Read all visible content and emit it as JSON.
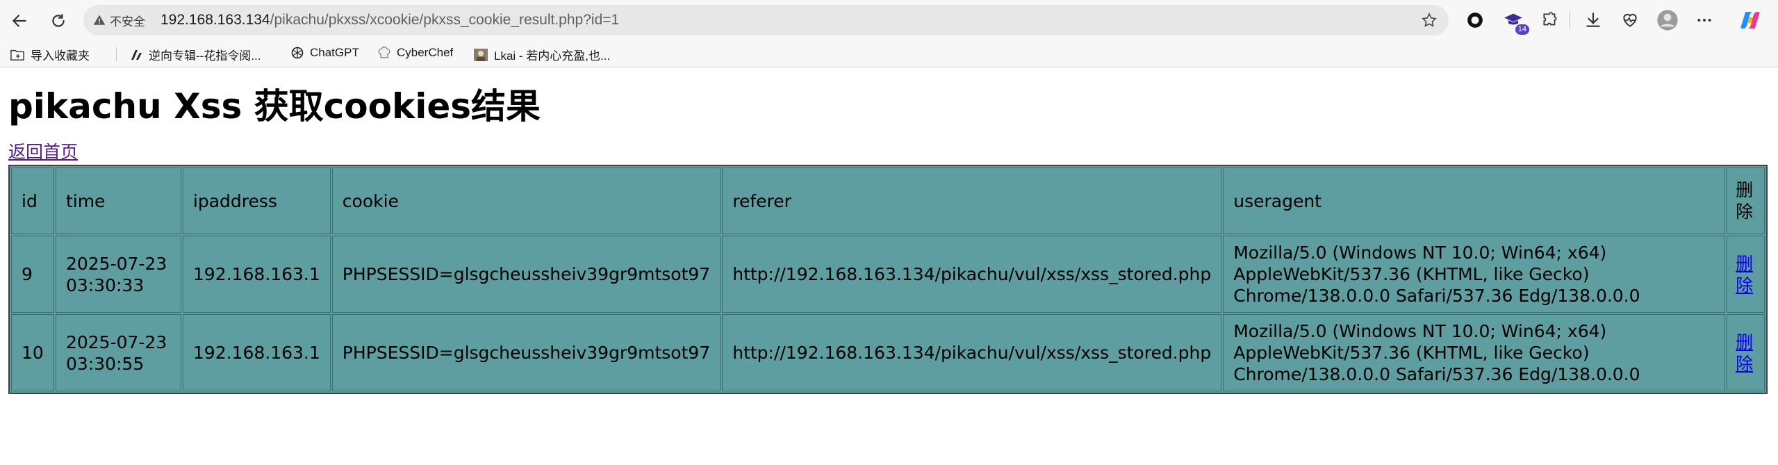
{
  "browser": {
    "security_label": "不安全",
    "url_host": "192.168.163.134",
    "url_path": "/pikachu/pkxss/xcookie/pkxss_cookie_result.php?id=1",
    "extension_badge": "14"
  },
  "bookmarks": [
    {
      "label": "导入收藏夹"
    },
    {
      "label": "逆向专辑--花指令阅..."
    },
    {
      "label": "ChatGPT"
    },
    {
      "label": "CyberChef"
    },
    {
      "label": "Lkai - 若内心充盈,也..."
    }
  ],
  "page": {
    "title": "pikachu Xss 获取cookies结果",
    "home_link": "返回首页"
  },
  "table": {
    "headers": [
      "id",
      "time",
      "ipaddress",
      "cookie",
      "referer",
      "useragent",
      "删除"
    ],
    "rows": [
      {
        "id": "9",
        "time": "2025-07-23 03:30:33",
        "ipaddress": "192.168.163.1",
        "cookie": "PHPSESSID=glsgcheussheiv39gr9mtsot97",
        "referer": "http://192.168.163.134/pikachu/vul/xss/xss_stored.php",
        "useragent": "Mozilla/5.0 (Windows NT 10.0; Win64; x64) AppleWebKit/537.36 (KHTML, like Gecko) Chrome/138.0.0.0 Safari/537.36 Edg/138.0.0.0",
        "delete": "删除"
      },
      {
        "id": "10",
        "time": "2025-07-23 03:30:55",
        "ipaddress": "192.168.163.1",
        "cookie": "PHPSESSID=glsgcheussheiv39gr9mtsot97",
        "referer": "http://192.168.163.134/pikachu/vul/xss/xss_stored.php",
        "useragent": "Mozilla/5.0 (Windows NT 10.0; Win64; x64) AppleWebKit/537.36 (KHTML, like Gecko) Chrome/138.0.0.0 Safari/537.36 Edg/138.0.0.0",
        "delete": "删除"
      }
    ]
  },
  "colors": {
    "table_bg": "#5f9ea0",
    "visited_link": "#551a8b",
    "link": "#0000ee"
  }
}
